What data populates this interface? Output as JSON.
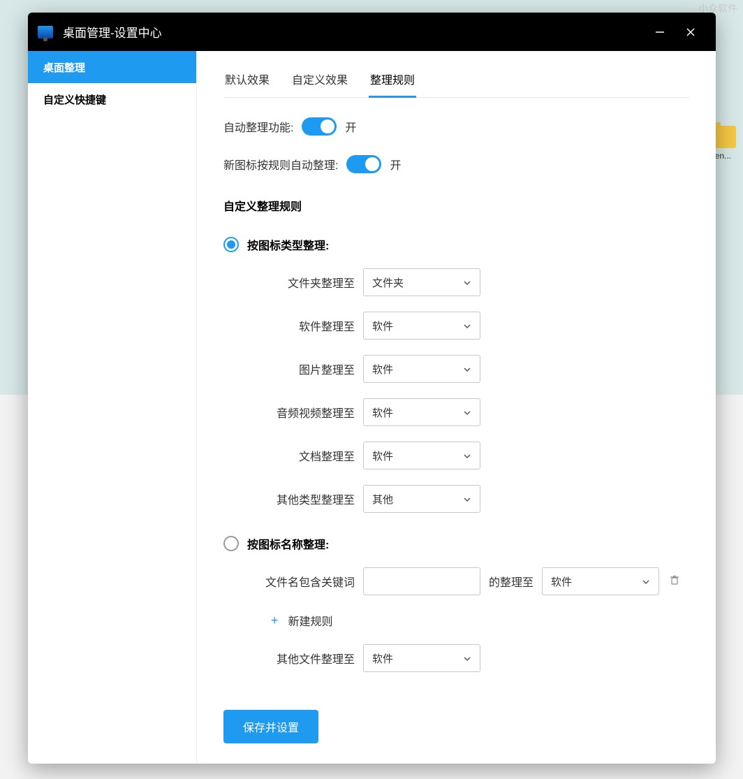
{
  "watermark": "小众软件",
  "bg_folder_label": "len...",
  "titlebar": {
    "title": "桌面管理-设置中心"
  },
  "sidebar": {
    "items": [
      {
        "label": "桌面整理",
        "active": true
      },
      {
        "label": "自定义快捷键",
        "active": false
      }
    ]
  },
  "tabs": [
    {
      "label": "默认效果",
      "active": false
    },
    {
      "label": "自定义效果",
      "active": false
    },
    {
      "label": "整理规则",
      "active": true
    }
  ],
  "toggles": {
    "auto_sort": {
      "label": "自动整理功能:",
      "state": "开"
    },
    "new_icon_sort": {
      "label": "新图标按规则自动整理:",
      "state": "开"
    }
  },
  "custom_rules_title": "自定义整理规则",
  "radio_options": {
    "by_type": {
      "label": "按图标类型整理:",
      "checked": true
    },
    "by_name": {
      "label": "按图标名称整理:",
      "checked": false
    }
  },
  "type_rules": [
    {
      "label": "文件夹整理至",
      "value": "文件夹"
    },
    {
      "label": "软件整理至",
      "value": "软件"
    },
    {
      "label": "图片整理至",
      "value": "软件"
    },
    {
      "label": "音频视频整理至",
      "value": "软件"
    },
    {
      "label": "文档整理至",
      "value": "软件"
    },
    {
      "label": "其他类型整理至",
      "value": "其他"
    }
  ],
  "name_rule": {
    "prefix_label": "文件名包含关键词",
    "keyword_value": "",
    "mid_label": "的整理至",
    "target_value": "软件"
  },
  "add_rule_label": "新建规则",
  "other_files": {
    "label": "其他文件整理至",
    "value": "软件"
  },
  "save_button": "保存并设置"
}
